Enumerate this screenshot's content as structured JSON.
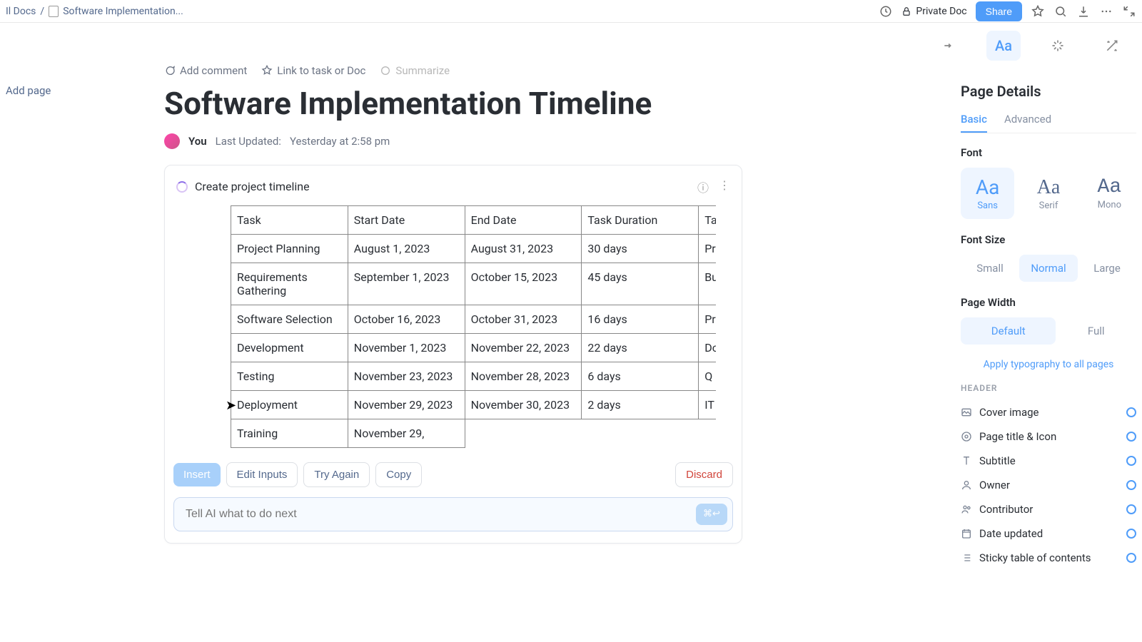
{
  "topbar": {
    "breadcrumb_root": "Il Docs",
    "breadcrumb_sep": "/",
    "breadcrumb_current": "Software Implementation...",
    "private_label": "Private Doc",
    "share_label": "Share"
  },
  "sidebar": {
    "add_page": "Add page"
  },
  "doc": {
    "add_comment": "Add comment",
    "link_task": "Link to task or Doc",
    "summarize": "Summarize",
    "title": "Software Implementation Timeline",
    "author": "You",
    "last_updated_label": "Last Updated:",
    "last_updated_value": "Yesterday at 2:58 pm"
  },
  "ai": {
    "header": "Create project timeline",
    "insert": "Insert",
    "edit_inputs": "Edit Inputs",
    "try_again": "Try Again",
    "copy": "Copy",
    "discard": "Discard",
    "input_placeholder": "Tell AI what to do next",
    "send_glyph": "⌘↩"
  },
  "table": {
    "headers": [
      "Task",
      "Start Date",
      "End Date",
      "Task Duration",
      "Ta"
    ],
    "rows": [
      [
        "Project Planning",
        "August 1, 2023",
        "August 31, 2023",
        "30 days",
        "Pr"
      ],
      [
        "Requirements Gathering",
        "September 1, 2023",
        "October 15, 2023",
        "45 days",
        "Bu"
      ],
      [
        "Software Selection",
        "October 16, 2023",
        "October 31, 2023",
        "16 days",
        "Pr"
      ],
      [
        "Development",
        "November 1, 2023",
        "November 22, 2023",
        "22 days",
        "Do"
      ],
      [
        "Testing",
        "November 23, 2023",
        "November 28, 2023",
        "6 days",
        "Q"
      ],
      [
        "Deployment",
        "November 29, 2023",
        "November 30, 2023",
        "2 days",
        "IT"
      ],
      [
        "Training",
        "November 29,",
        "",
        "",
        ""
      ]
    ]
  },
  "right": {
    "title": "Page Details",
    "tab_basic": "Basic",
    "tab_advanced": "Advanced",
    "font_label": "Font",
    "font_sans": "Sans",
    "font_serif": "Serif",
    "font_mono": "Mono",
    "font_aa": "Aa",
    "font_size_label": "Font Size",
    "size_small": "Small",
    "size_normal": "Normal",
    "size_large": "Large",
    "page_width_label": "Page Width",
    "width_default": "Default",
    "width_full": "Full",
    "apply_link": "Apply typography to all pages",
    "header_label": "HEADER",
    "cover_image": "Cover image",
    "page_title_icon": "Page title & Icon",
    "subtitle": "Subtitle",
    "owner": "Owner",
    "contributor": "Contributor",
    "date_updated": "Date updated",
    "sticky_toc": "Sticky table of contents"
  }
}
